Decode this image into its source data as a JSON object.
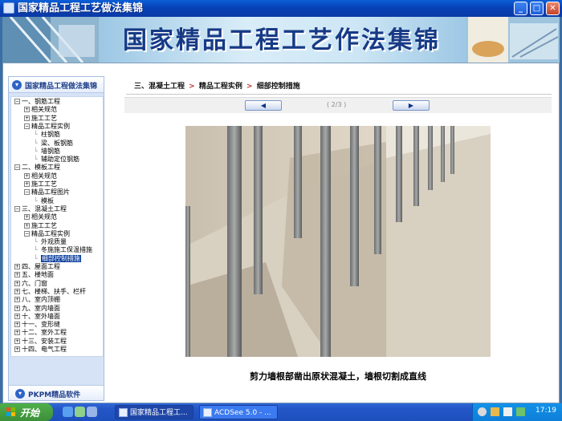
{
  "window": {
    "title": "国家精品工程工艺做法集锦",
    "controls": {
      "minimize": "_",
      "maximize": "□",
      "close": "✕"
    }
  },
  "banner": {
    "title": "国家精品工程工艺作法集锦"
  },
  "sidebar": {
    "header": "国家精品工程做法集锦",
    "footer": "PKPM精品软件",
    "tree": [
      {
        "toggle": "−",
        "label": "一、钢筋工程"
      },
      {
        "toggle": "+",
        "label": "相关规范"
      },
      {
        "toggle": "+",
        "label": "施工工艺"
      },
      {
        "toggle": "−",
        "label": "精品工程实例"
      },
      {
        "toggle": "",
        "label": "柱钢筋"
      },
      {
        "toggle": "",
        "label": "梁、板钢筋"
      },
      {
        "toggle": "",
        "label": "墙钢筋"
      },
      {
        "toggle": "",
        "label": "辅助定位钢筋"
      },
      {
        "toggle": "−",
        "label": "二、模板工程"
      },
      {
        "toggle": "+",
        "label": "相关规范"
      },
      {
        "toggle": "+",
        "label": "施工工艺"
      },
      {
        "toggle": "−",
        "label": "精品工程图片"
      },
      {
        "toggle": "",
        "label": "模板"
      },
      {
        "toggle": "−",
        "label": "三、混凝土工程"
      },
      {
        "toggle": "+",
        "label": "相关规范"
      },
      {
        "toggle": "+",
        "label": "施工工艺"
      },
      {
        "toggle": "−",
        "label": "精品工程实例"
      },
      {
        "toggle": "",
        "label": "外观质量"
      },
      {
        "toggle": "",
        "label": "冬施施工保温措施"
      },
      {
        "toggle": "",
        "label": "细部控制措施"
      },
      {
        "toggle": "+",
        "label": "四、屋面工程"
      },
      {
        "toggle": "+",
        "label": "五、楼地面"
      },
      {
        "toggle": "+",
        "label": "六、门窗"
      },
      {
        "toggle": "+",
        "label": "七、楼梯、扶手、栏杆"
      },
      {
        "toggle": "+",
        "label": "八、室内顶棚"
      },
      {
        "toggle": "+",
        "label": "九、室内墙面"
      },
      {
        "toggle": "+",
        "label": "十、室外墙面"
      },
      {
        "toggle": "+",
        "label": "十一、变形缝"
      },
      {
        "toggle": "+",
        "label": "十二、室外工程"
      },
      {
        "toggle": "+",
        "label": "十三、安装工程"
      },
      {
        "toggle": "+",
        "label": "十四、电气工程"
      }
    ]
  },
  "content": {
    "breadcrumb": [
      "三、混凝土工程",
      "精品工程实例",
      "细部控制措施"
    ],
    "page_indicator": "( 2/3 )",
    "prev_glyph": "◀",
    "next_glyph": "▶",
    "caption": "剪力墙根部凿出原状混凝土，墙根切割成直线"
  },
  "taskbar": {
    "start": "开始",
    "tasks": [
      "国家精品工程工...",
      "ACDSee 5.0 - ..."
    ],
    "clock": "17:19"
  }
}
